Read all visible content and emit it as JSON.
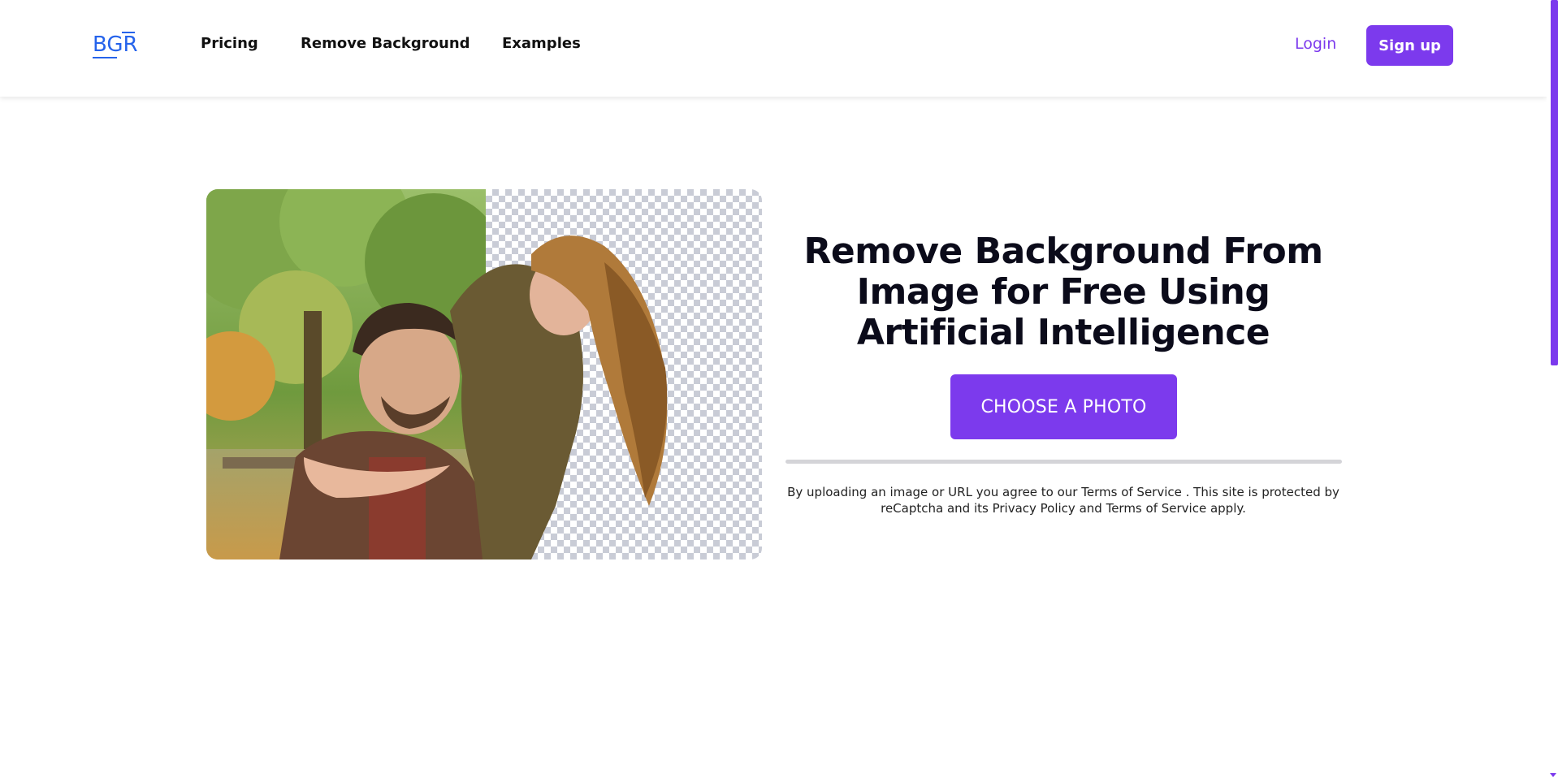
{
  "colors": {
    "accent": "#7c3aed",
    "logo": "#2563eb",
    "heading": "#0b0b1a",
    "progress_track": "#d4d4d8"
  },
  "header": {
    "logo_text": "BGR",
    "nav": {
      "pricing": "Pricing",
      "remove_background": "Remove Background",
      "examples": "Examples"
    },
    "login": "Login",
    "signup": "Sign up"
  },
  "hero": {
    "image_icon": "before-after-photo",
    "title": "Remove Background From Image for Free Using Artificial Intelligence",
    "cta": "CHOOSE A PHOTO",
    "progress": 0,
    "legal": {
      "part1": "By uploading an image or URL you agree to our ",
      "terms_link": "Terms of Service",
      "part2": " . This site is protected by reCaptcha and its ",
      "privacy_link": "Privacy Policy",
      "part3": " and ",
      "terms_link_2": "Terms of Service",
      "part4": " apply."
    }
  }
}
